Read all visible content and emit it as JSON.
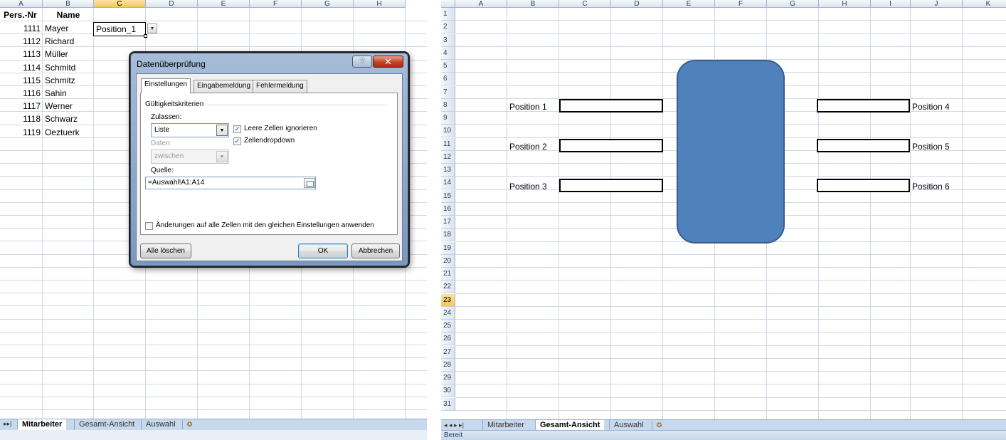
{
  "left": {
    "columns": [
      "A",
      "B",
      "C",
      "D",
      "E",
      "F",
      "G",
      "H"
    ],
    "selected_column": "C",
    "header_row": {
      "pers_nr": "Pers.-Nr",
      "name": "Name"
    },
    "rows": [
      {
        "nr": "1111",
        "name": "Mayer"
      },
      {
        "nr": "1112",
        "name": "Richard"
      },
      {
        "nr": "1113",
        "name": "Müller"
      },
      {
        "nr": "1114",
        "name": "Schmitd"
      },
      {
        "nr": "1115",
        "name": "Schmitz"
      },
      {
        "nr": "1116",
        "name": "Sahin"
      },
      {
        "nr": "1117",
        "name": "Werner"
      },
      {
        "nr": "1118",
        "name": "Schwarz"
      },
      {
        "nr": "1119",
        "name": "Oeztuerk"
      }
    ],
    "active_cell_value": "Position_1",
    "dropdown_arrow": "▼",
    "sheet_nav": "▸▸|",
    "sheet_tabs": [
      "Mitarbeiter",
      "Gesamt-Ansicht",
      "Auswahl"
    ],
    "active_sheet": "Mitarbeiter",
    "new_sheet_icon": "✪"
  },
  "dialog": {
    "title": "Datenüberprüfung",
    "help_label": "?",
    "close_label": "✕",
    "tabs": [
      "Einstellungen",
      "Eingabemeldung",
      "Fehlermeldung"
    ],
    "active_tab": "Einstellungen",
    "group_label": "Gültigkeitskriterien",
    "allow_label": "Zulassen:",
    "allow_value": "Liste",
    "data_label": "Daten:",
    "data_value": "zwischen",
    "ignore_blank_label": "Leere Zellen ignorieren",
    "ignore_blank_checked": true,
    "in_cell_dropdown_label": "Zellendropdown",
    "in_cell_dropdown_checked": true,
    "source_label": "Quelle:",
    "source_value": "=Auswahl!A1:A14",
    "apply_all_label": "Änderungen auf alle Zellen mit den gleichen Einstellungen anwenden",
    "apply_all_checked": false,
    "clear_all_label": "Alle löschen",
    "ok_label": "OK",
    "cancel_label": "Abbrechen",
    "check_mark": "✓",
    "combo_arrow": "▼"
  },
  "right": {
    "columns": [
      "A",
      "B",
      "C",
      "D",
      "E",
      "F",
      "G",
      "H",
      "I",
      "J",
      "K"
    ],
    "rows": [
      "1",
      "2",
      "3",
      "4",
      "5",
      "6",
      "7",
      "8",
      "9",
      "10",
      "11",
      "12",
      "13",
      "14",
      "15",
      "16",
      "17",
      "18",
      "19",
      "20",
      "21",
      "22",
      "23",
      "24",
      "25",
      "26",
      "27",
      "28",
      "29",
      "30",
      "31"
    ],
    "selected_row": "23",
    "positions_left": [
      "Position 1",
      "Position 2",
      "Position 3"
    ],
    "positions_right": [
      "Position 4",
      "Position 5",
      "Position 6"
    ],
    "sheet_nav": "◂ ◂ ▸ ▸|",
    "sheet_tabs": [
      "Mitarbeiter",
      "Gesamt-Ansicht",
      "Auswahl"
    ],
    "active_sheet": "Gesamt-Ansicht",
    "new_sheet_icon": "✪",
    "status_text": "Bereit"
  },
  "colors": {
    "accent_shape": "#4f81bd",
    "header_bg": "#dbe3ef",
    "selected_header": "#f5c65c",
    "gridline": "#d0d7e5"
  }
}
